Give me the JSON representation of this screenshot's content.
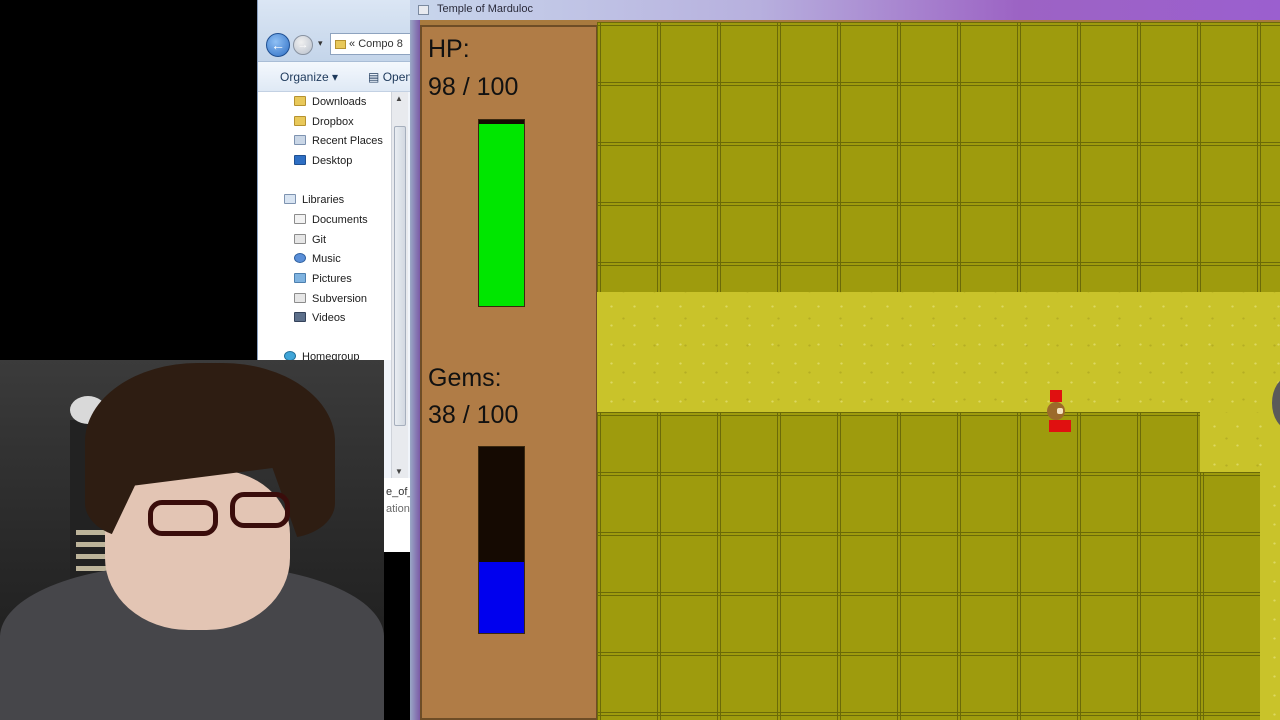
{
  "explorer": {
    "address_prefix": "«",
    "address_text": "Compo 8",
    "toolbar": {
      "organize": "Organize ▾",
      "open": "Open"
    },
    "favorites": [
      {
        "label": "Downloads"
      },
      {
        "label": "Dropbox"
      },
      {
        "label": "Recent Places"
      },
      {
        "label": "Desktop"
      }
    ],
    "libraries_header": "Libraries",
    "libraries": [
      {
        "label": "Documents"
      },
      {
        "label": "Git"
      },
      {
        "label": "Music"
      },
      {
        "label": "Pictures"
      },
      {
        "label": "Subversion"
      },
      {
        "label": "Videos"
      }
    ],
    "homegroup": "Homegroup",
    "file_fragment_1": "e_of_",
    "file_fragment_2": "ation"
  },
  "game": {
    "window_title": "Temple of Marduloc",
    "hud": {
      "hp_label": "HP:",
      "hp_value": "98  / 100",
      "hp": 98,
      "hp_max": 100,
      "gems_label": "Gems:",
      "gems_value": "38  / 100",
      "gems": 38,
      "gems_max": 100
    },
    "colors": {
      "hp_fill": "#00e600",
      "gems_fill": "#0000ee",
      "bar_empty": "#150a02",
      "hud_bg": "#b07c46",
      "wall_tile": "#9e9b0d",
      "floor": "#c9c32a",
      "player": "#e01010"
    }
  }
}
